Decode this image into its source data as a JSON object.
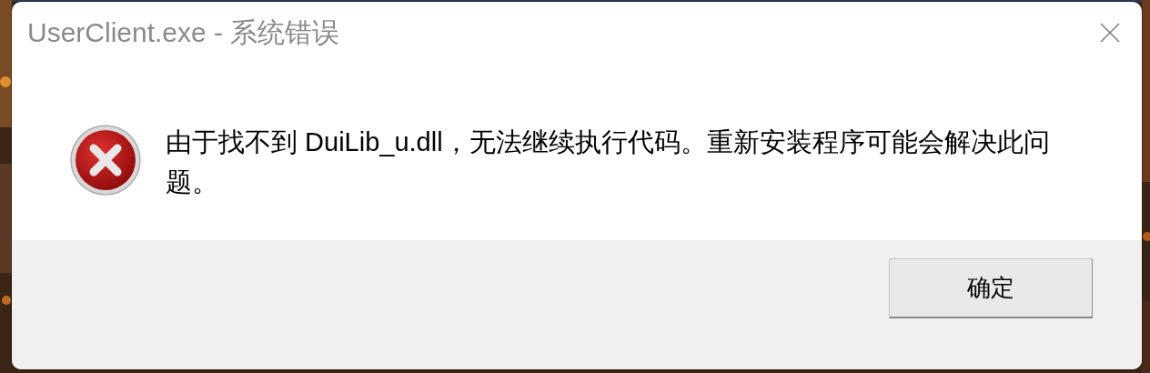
{
  "window": {
    "title": "UserClient.exe - 系统错误"
  },
  "message": {
    "kind": "error",
    "text": "由于找不到 DuiLib_u.dll，无法继续执行代码。重新安装程序可能会解决此问题。"
  },
  "buttons": [
    {
      "label": "确定"
    }
  ]
}
